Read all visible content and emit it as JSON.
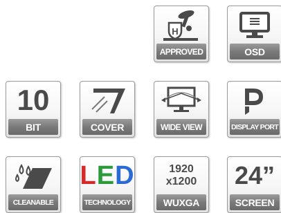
{
  "badges": {
    "approved": {
      "label": "APPROVED",
      "icon": "certification-mark-icon"
    },
    "osd": {
      "label": "OSD",
      "icon": "monitor-menu-icon"
    },
    "bit": {
      "label": "BIT",
      "value": "10"
    },
    "cover": {
      "label": "COVER",
      "icon": "glare-cover-icon"
    },
    "wideview": {
      "label": "WIDE VIEW",
      "icon": "wide-viewing-angle-icon"
    },
    "displayport": {
      "label": "DISPLAY PORT",
      "icon": "displayport-logo-icon"
    },
    "cleanable": {
      "label": "CLEANABLE",
      "icon": "water-drops-icon"
    },
    "led": {
      "label": "TECHNOLOGY",
      "letters": [
        "L",
        "E",
        "D"
      ],
      "letter_colors": [
        "#d42a2a",
        "#2a9a3a",
        "#2a6ad4"
      ]
    },
    "wuxga": {
      "label": "WUXGA",
      "line1": "1920",
      "line2": "x1200"
    },
    "screen": {
      "label": "SCREEN",
      "value": "24”"
    }
  },
  "colors": {
    "badge_bar": "#7a7a7a",
    "badge_text": "#ffffff",
    "icon_gray": "#4a4a4a"
  }
}
